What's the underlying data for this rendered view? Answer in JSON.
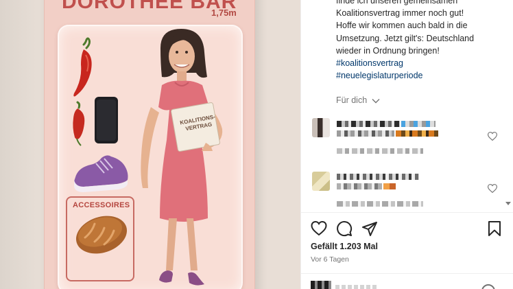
{
  "post_image": {
    "brand_text": "DOROTHEE BÄR",
    "figure_height": "1,75m",
    "book_title": "KOALITIONS-VERTRAG",
    "accessories_label": "ACCESSOIRES"
  },
  "caption": {
    "lines": [
      "finde ich unseren gemeinsamen",
      "Koalitionsvertrag immer noch gut!",
      "Hoffe wir kommen auch bald in die",
      "Umsetzung. Jetzt gilt's: Deutschland",
      "wieder in Ordnung bringen!"
    ],
    "hashtags": [
      "#koalitionsvertrag",
      "#neuelegislaturperiode"
    ]
  },
  "translate_label": "Für dich",
  "icons": {
    "like": "heart-icon",
    "comment": "comment-bubble-icon",
    "share": "paper-plane-icon",
    "save": "bookmark-icon",
    "comment_like": "heart-outline-icon",
    "translate_toggle": "chevron-down-icon",
    "scroll": "scroll-down-arrow-icon"
  },
  "likes_label": "Gefällt 1.203 Mal",
  "post_age": "Vor 6 Tagen",
  "colors": {
    "accent_link": "#00376b",
    "card_pink": "#f2cfc6",
    "brand_red": "#c0504d",
    "dress_pink": "#e0707a"
  }
}
